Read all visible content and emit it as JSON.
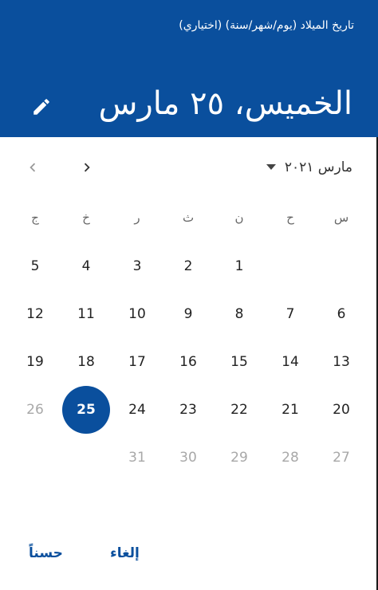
{
  "header": {
    "label": "تاريخ الميلاد (يوم/شهر/سنة) (اختياري)",
    "selected_date": "الخميس، ٢٥ مارس",
    "edit_icon": "pencil-icon"
  },
  "navigation": {
    "month_label": "مارس ٢٠٢١",
    "dropdown_icon": "triangle-down-icon",
    "prev_icon": "chevron-left-icon",
    "next_icon": "chevron-right-icon"
  },
  "weekdays": [
    "س",
    "ح",
    "ن",
    "ث",
    "ر",
    "خ",
    "ج"
  ],
  "weeks": [
    [
      "",
      "",
      "1",
      "2",
      "3",
      "4",
      "5"
    ],
    [
      "6",
      "7",
      "8",
      "9",
      "10",
      "11",
      "12"
    ],
    [
      "13",
      "14",
      "15",
      "16",
      "17",
      "18",
      "19"
    ],
    [
      "20",
      "21",
      "22",
      "23",
      "24",
      "25",
      "26"
    ],
    [
      "27",
      "28",
      "29",
      "30",
      "31",
      "",
      ""
    ]
  ],
  "selected_day": "25",
  "muted_days": [
    "26",
    "27",
    "28",
    "29",
    "30",
    "31"
  ],
  "actions": {
    "cancel_label": "إلغاء",
    "ok_label": "حسناً"
  },
  "colors": {
    "accent": "#0a4f9d",
    "muted_text": "#a8a8a8"
  }
}
